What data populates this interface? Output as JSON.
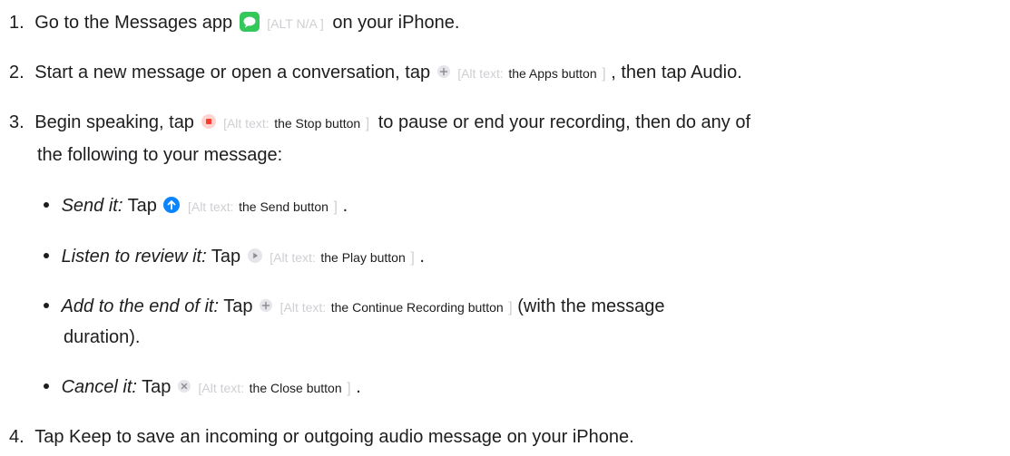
{
  "steps": [
    {
      "number": "1.",
      "parts": [
        "Go to the Messages app",
        "[ALT N/A ]",
        "on your iPhone."
      ]
    },
    {
      "number": "2.",
      "parts": [
        "Start a new message or open a conversation, tap",
        "[Alt text:",
        "the Apps button",
        "]",
        ", then tap Audio."
      ]
    },
    {
      "number": "3.",
      "parts": [
        "Begin speaking, tap",
        "[Alt text:",
        "the Stop button",
        "]",
        "to pause or end your recording, then do any of"
      ],
      "continuation": "the following to your message:"
    },
    {
      "number": "4.",
      "parts": [
        "Tap Keep to save an incoming or outgoing audio message on your iPhone."
      ]
    }
  ],
  "bullets": [
    {
      "label": "Send it:",
      "tap": "Tap",
      "alt_prefix": "[Alt text:",
      "alt_value": "the Send button",
      "alt_close": "]",
      "suffix": "."
    },
    {
      "label": "Listen to review it:",
      "tap": "Tap",
      "alt_prefix": "[Alt text:",
      "alt_value": "the Play button",
      "alt_close": "]",
      "suffix": "."
    },
    {
      "label": "Add to the end of it:",
      "tap": "Tap",
      "alt_prefix": "[Alt text:",
      "alt_value": "the Continue Recording button",
      "alt_close": "]",
      "suffix": "(with the message",
      "continuation": "duration)."
    },
    {
      "label": "Cancel it:",
      "tap": "Tap",
      "alt_prefix": "[Alt text:",
      "alt_value": "the Close button",
      "alt_close": "]",
      "suffix": "."
    }
  ],
  "icons": {
    "messages": "messages-app-icon",
    "apps": "plus-circle-icon",
    "stop": "stop-icon",
    "send": "send-arrow-icon",
    "play": "play-icon",
    "continue": "plus-circle-icon",
    "close": "close-icon"
  },
  "colors": {
    "text": "#1d1d1f",
    "alt_gray": "#cfcfd3",
    "messages_green": "#34c759",
    "stop_red": "#ff3b30",
    "send_blue": "#0a84ff",
    "icon_gray": "#e5e5ea"
  }
}
